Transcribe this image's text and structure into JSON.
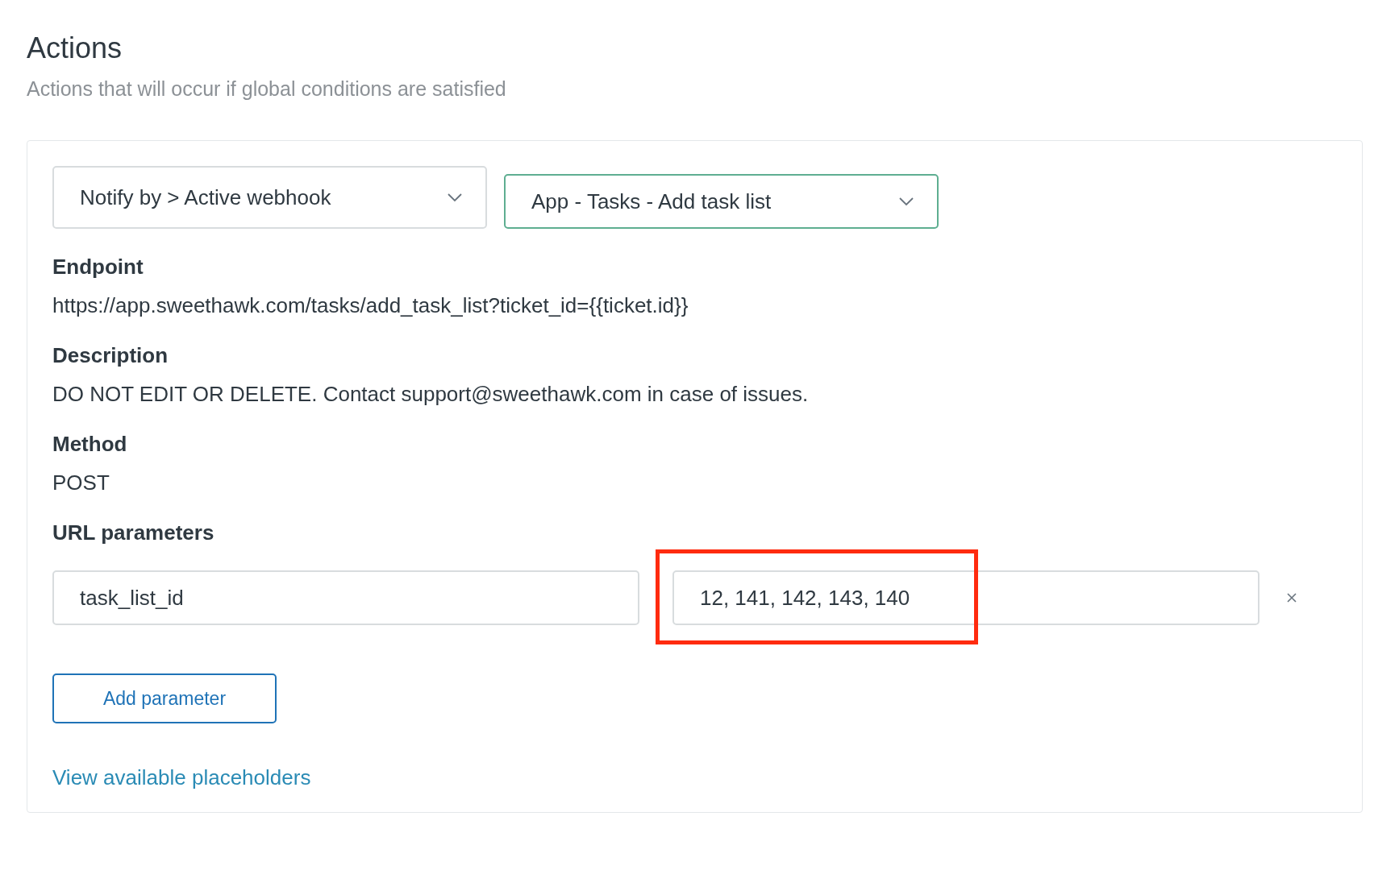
{
  "header": {
    "title": "Actions",
    "subtitle": "Actions that will occur if global conditions are satisfied"
  },
  "selects": [
    {
      "value": "Notify by > Active webhook",
      "focused": false
    },
    {
      "value": "App - Tasks - Add task list",
      "focused": true
    }
  ],
  "details": [
    {
      "label": "Endpoint",
      "value": "https://app.sweethawk.com/tasks/add_task_list?ticket_id={{ticket.id}}"
    },
    {
      "label": "Description",
      "value": "DO NOT EDIT OR DELETE. Contact support@sweethawk.com in case of issues."
    },
    {
      "label": "Method",
      "value": "POST"
    }
  ],
  "url_parameters": {
    "label": "URL parameters",
    "rows": [
      {
        "key": "task_list_id",
        "value": "12, 141, 142, 143, 140",
        "value_highlighted": true
      }
    ]
  },
  "add_button": "Add parameter",
  "placeholders_link": "View available placeholders"
}
